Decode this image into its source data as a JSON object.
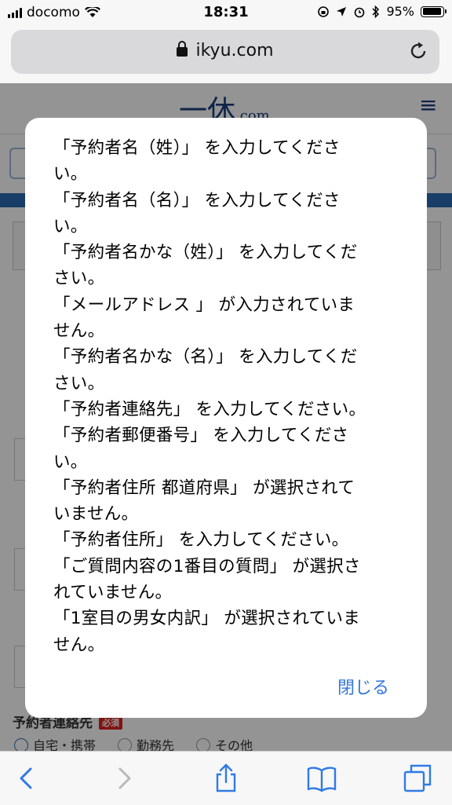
{
  "status_bar": {
    "carrier": "docomo",
    "time": "18:31",
    "battery": "95%",
    "battery_level": 0.95
  },
  "browser": {
    "url": "ikyu.com"
  },
  "page": {
    "logo_main": "一休",
    "logo_suffix": ".com",
    "contact_label": "予約者連絡先",
    "required_badge": "必須",
    "contact_options": [
      "自宅・携帯",
      "勤務先",
      "その他"
    ]
  },
  "alert": {
    "lines": [
      "「予約者名（姓）」 を入力してくださ",
      "い。",
      "「予約者名（名）」 を入力してくださ",
      "い。",
      "「予約者名かな（姓）」 を入力してくだ",
      "さい。",
      "「メールアドレス 」 が入力されていま",
      "せん。",
      "「予約者名かな（名）」 を入力してくだ",
      "さい。",
      "「予約者連絡先」 を入力してください。",
      "「予約者郵便番号」 を入力してくださ",
      "い。",
      "「予約者住所 都道府県」 が選択されて",
      "いません。",
      "「予約者住所」 を入力してください。",
      "「ご質問内容の1番目の質問」 が選択さ",
      "れていません。",
      "「1室目の男女内訳」 が選択されていま",
      "せん。"
    ],
    "close_label": "閉じる"
  },
  "toolbar": {
    "icons": [
      "back-icon",
      "forward-icon",
      "share-icon",
      "bookmarks-icon",
      "tabs-icon"
    ]
  }
}
